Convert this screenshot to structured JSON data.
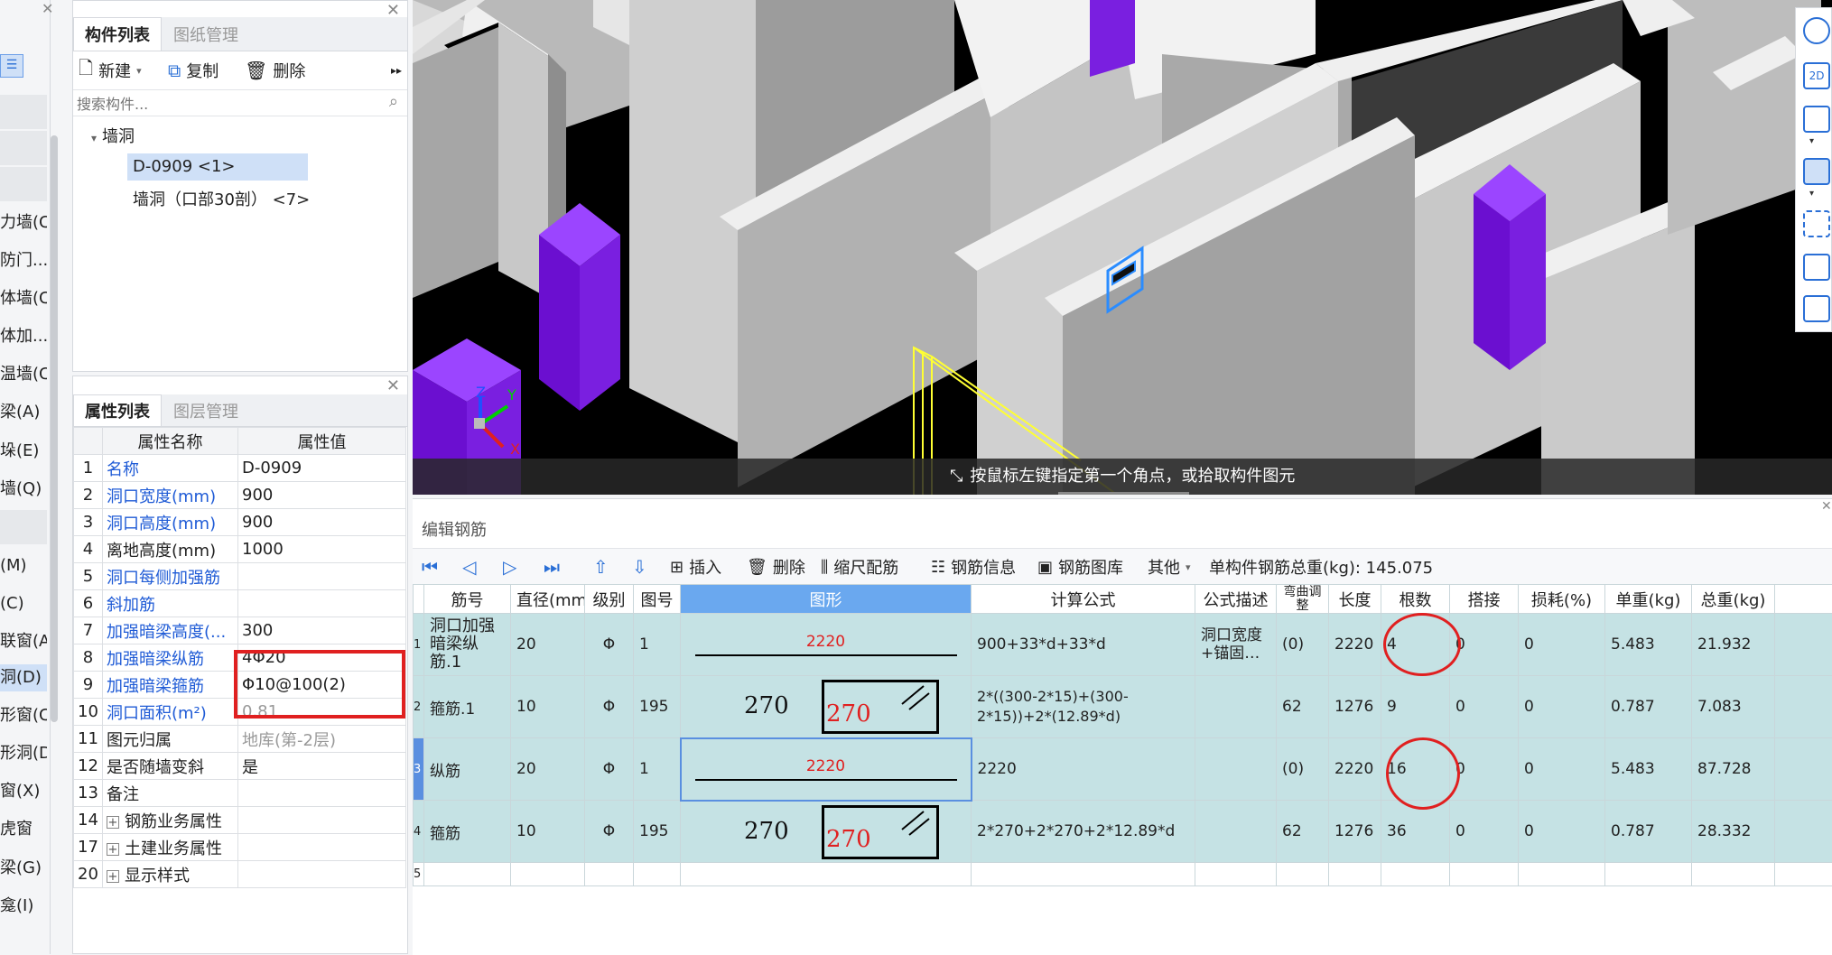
{
  "left_sidebar": {
    "items": [
      "力墙(C",
      "防门...",
      "体墙(C",
      "体加...",
      "温墙(C",
      "梁(A)",
      "垛(E)",
      "墙(Q)",
      "(M)",
      "(C)",
      "联窗(A",
      "洞(D)",
      "形窗(C",
      "形洞(D",
      "窗(X)",
      "虎窗",
      "梁(G)",
      "龛(I)"
    ]
  },
  "component_panel": {
    "tabs": [
      "构件列表",
      "图纸管理"
    ],
    "toolbar": {
      "new_label": "新建",
      "copy_label": "复制",
      "delete_label": "删除"
    },
    "search_placeholder": "搜索构件...",
    "tree": {
      "group": "墙洞",
      "items": [
        "D-0909 <1>",
        "墙洞（口部30剖） <7>"
      ]
    }
  },
  "property_panel": {
    "tabs": [
      "属性列表",
      "图层管理"
    ],
    "headers": {
      "name": "属性名称",
      "value": "属性值"
    },
    "rows": [
      {
        "num": "1",
        "name": "名称",
        "value": "D-0909"
      },
      {
        "num": "2",
        "name": "洞口宽度(mm)",
        "value": "900"
      },
      {
        "num": "3",
        "name": "洞口高度(mm)",
        "value": "900"
      },
      {
        "num": "4",
        "name": "离地高度(mm)",
        "value": "1000"
      },
      {
        "num": "5",
        "name": "洞口每侧加强筋",
        "value": ""
      },
      {
        "num": "6",
        "name": "斜加筋",
        "value": ""
      },
      {
        "num": "7",
        "name": "加强暗梁高度(...",
        "value": "300"
      },
      {
        "num": "8",
        "name": "加强暗梁纵筋",
        "value": "4\u000120"
      },
      {
        "num": "9",
        "name": "加强暗梁箍筋",
        "value": "\u000110@100(2)"
      },
      {
        "num": "10",
        "name": "洞口面积(m²)",
        "value": "0.81"
      },
      {
        "num": "11",
        "name": "图元归属",
        "value": "地库(第-2层)"
      },
      {
        "num": "12",
        "name": "是否随墙变斜",
        "value": "是"
      },
      {
        "num": "13",
        "name": "备注",
        "value": ""
      },
      {
        "num": "14",
        "name": "钢筋业务属性",
        "value": ""
      },
      {
        "num": "17",
        "name": "土建业务属性",
        "value": ""
      },
      {
        "num": "20",
        "name": "显示样式",
        "value": ""
      }
    ]
  },
  "viewport": {
    "status_text": "按鼠标左键指定第一个角点，或拾取构件图元",
    "axes": {
      "x": "X",
      "y": "Y",
      "z": "Z"
    }
  },
  "rebar_editor": {
    "title": "编辑钢筋",
    "toolbar": {
      "insert": "插入",
      "delete": "删除",
      "scale_rebar": "缩尺配筋",
      "rebar_info": "钢筋信息",
      "rebar_library": "钢筋图库",
      "other": "其他",
      "total_weight": "单构件钢筋总重(kg): 145.075"
    },
    "columns": [
      "筋号",
      "直径(mm)",
      "级别",
      "图号",
      "图形",
      "计算公式",
      "公式描述",
      "弯曲调整",
      "长度",
      "根数",
      "搭接",
      "损耗(%)",
      "单重(kg)",
      "总重(kg)"
    ],
    "rows": [
      {
        "idx": "1",
        "name": "洞口加强暗梁纵筋.1",
        "diameter": "20",
        "grade": "Φ",
        "figure": "1",
        "shape_value": "2220",
        "formula": "900+33*d+33*d",
        "desc": "洞口宽度+锚固…",
        "bend": "(0)",
        "length": "2220",
        "count": "4",
        "lap": "0",
        "loss": "0",
        "unit_weight": "5.483",
        "total_weight": "21.932"
      },
      {
        "idx": "2",
        "name": "箍筋.1",
        "diameter": "10",
        "grade": "Φ",
        "figure": "195",
        "shape_left": "270",
        "shape_value": "270",
        "formula": "2*((300-2*15)+(300-2*15))+2*(12.89*d)",
        "desc": "",
        "bend": "62",
        "length": "1276",
        "count": "9",
        "lap": "0",
        "loss": "0",
        "unit_weight": "0.787",
        "total_weight": "7.083"
      },
      {
        "idx": "3",
        "name": "纵筋",
        "diameter": "20",
        "grade": "Φ",
        "figure": "1",
        "shape_value": "2220",
        "formula": "2220",
        "desc": "",
        "bend": "(0)",
        "length": "2220",
        "count": "16",
        "lap": "0",
        "loss": "0",
        "unit_weight": "5.483",
        "total_weight": "87.728"
      },
      {
        "idx": "4",
        "name": "箍筋",
        "diameter": "10",
        "grade": "Φ",
        "figure": "195",
        "shape_left": "270",
        "shape_value": "270",
        "formula": "2*270+2*270+2*12.89*d",
        "desc": "",
        "bend": "62",
        "length": "1276",
        "count": "36",
        "lap": "0",
        "loss": "0",
        "unit_weight": "0.787",
        "total_weight": "28.332"
      },
      {
        "idx": "5",
        "name": "",
        "diameter": "",
        "grade": "",
        "figure": "",
        "shape_value": "",
        "formula": "",
        "desc": "",
        "bend": "",
        "length": "",
        "count": "",
        "lap": "",
        "loss": "",
        "unit_weight": "",
        "total_weight": ""
      }
    ]
  },
  "right_toolbar": {
    "icons": [
      "orbit-icon",
      "2d-icon",
      "3d-box-icon",
      "3d-solid-icon",
      "fullscreen-icon",
      "view-cube-icon",
      "layer-settings-icon"
    ],
    "label_2d": "2D"
  },
  "colors": {
    "accent_blue": "#1f5bd6",
    "highlight_red": "#e02020",
    "row_teal": "#c5e2e4",
    "pillar_purple": "#7a1fe0"
  }
}
